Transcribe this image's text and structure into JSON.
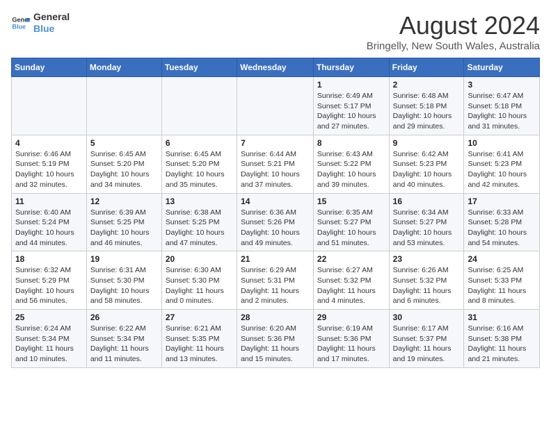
{
  "logo": {
    "line1": "General",
    "line2": "Blue"
  },
  "title": "August 2024",
  "subtitle": "Bringelly, New South Wales, Australia",
  "weekdays": [
    "Sunday",
    "Monday",
    "Tuesday",
    "Wednesday",
    "Thursday",
    "Friday",
    "Saturday"
  ],
  "weeks": [
    [
      {
        "day": "",
        "info": ""
      },
      {
        "day": "",
        "info": ""
      },
      {
        "day": "",
        "info": ""
      },
      {
        "day": "",
        "info": ""
      },
      {
        "day": "1",
        "info": "Sunrise: 6:49 AM\nSunset: 5:17 PM\nDaylight: 10 hours\nand 27 minutes."
      },
      {
        "day": "2",
        "info": "Sunrise: 6:48 AM\nSunset: 5:18 PM\nDaylight: 10 hours\nand 29 minutes."
      },
      {
        "day": "3",
        "info": "Sunrise: 6:47 AM\nSunset: 5:18 PM\nDaylight: 10 hours\nand 31 minutes."
      }
    ],
    [
      {
        "day": "4",
        "info": "Sunrise: 6:46 AM\nSunset: 5:19 PM\nDaylight: 10 hours\nand 32 minutes."
      },
      {
        "day": "5",
        "info": "Sunrise: 6:45 AM\nSunset: 5:20 PM\nDaylight: 10 hours\nand 34 minutes."
      },
      {
        "day": "6",
        "info": "Sunrise: 6:45 AM\nSunset: 5:20 PM\nDaylight: 10 hours\nand 35 minutes."
      },
      {
        "day": "7",
        "info": "Sunrise: 6:44 AM\nSunset: 5:21 PM\nDaylight: 10 hours\nand 37 minutes."
      },
      {
        "day": "8",
        "info": "Sunrise: 6:43 AM\nSunset: 5:22 PM\nDaylight: 10 hours\nand 39 minutes."
      },
      {
        "day": "9",
        "info": "Sunrise: 6:42 AM\nSunset: 5:23 PM\nDaylight: 10 hours\nand 40 minutes."
      },
      {
        "day": "10",
        "info": "Sunrise: 6:41 AM\nSunset: 5:23 PM\nDaylight: 10 hours\nand 42 minutes."
      }
    ],
    [
      {
        "day": "11",
        "info": "Sunrise: 6:40 AM\nSunset: 5:24 PM\nDaylight: 10 hours\nand 44 minutes."
      },
      {
        "day": "12",
        "info": "Sunrise: 6:39 AM\nSunset: 5:25 PM\nDaylight: 10 hours\nand 46 minutes."
      },
      {
        "day": "13",
        "info": "Sunrise: 6:38 AM\nSunset: 5:25 PM\nDaylight: 10 hours\nand 47 minutes."
      },
      {
        "day": "14",
        "info": "Sunrise: 6:36 AM\nSunset: 5:26 PM\nDaylight: 10 hours\nand 49 minutes."
      },
      {
        "day": "15",
        "info": "Sunrise: 6:35 AM\nSunset: 5:27 PM\nDaylight: 10 hours\nand 51 minutes."
      },
      {
        "day": "16",
        "info": "Sunrise: 6:34 AM\nSunset: 5:27 PM\nDaylight: 10 hours\nand 53 minutes."
      },
      {
        "day": "17",
        "info": "Sunrise: 6:33 AM\nSunset: 5:28 PM\nDaylight: 10 hours\nand 54 minutes."
      }
    ],
    [
      {
        "day": "18",
        "info": "Sunrise: 6:32 AM\nSunset: 5:29 PM\nDaylight: 10 hours\nand 56 minutes."
      },
      {
        "day": "19",
        "info": "Sunrise: 6:31 AM\nSunset: 5:30 PM\nDaylight: 10 hours\nand 58 minutes."
      },
      {
        "day": "20",
        "info": "Sunrise: 6:30 AM\nSunset: 5:30 PM\nDaylight: 11 hours\nand 0 minutes."
      },
      {
        "day": "21",
        "info": "Sunrise: 6:29 AM\nSunset: 5:31 PM\nDaylight: 11 hours\nand 2 minutes."
      },
      {
        "day": "22",
        "info": "Sunrise: 6:27 AM\nSunset: 5:32 PM\nDaylight: 11 hours\nand 4 minutes."
      },
      {
        "day": "23",
        "info": "Sunrise: 6:26 AM\nSunset: 5:32 PM\nDaylight: 11 hours\nand 6 minutes."
      },
      {
        "day": "24",
        "info": "Sunrise: 6:25 AM\nSunset: 5:33 PM\nDaylight: 11 hours\nand 8 minutes."
      }
    ],
    [
      {
        "day": "25",
        "info": "Sunrise: 6:24 AM\nSunset: 5:34 PM\nDaylight: 11 hours\nand 10 minutes."
      },
      {
        "day": "26",
        "info": "Sunrise: 6:22 AM\nSunset: 5:34 PM\nDaylight: 11 hours\nand 11 minutes."
      },
      {
        "day": "27",
        "info": "Sunrise: 6:21 AM\nSunset: 5:35 PM\nDaylight: 11 hours\nand 13 minutes."
      },
      {
        "day": "28",
        "info": "Sunrise: 6:20 AM\nSunset: 5:36 PM\nDaylight: 11 hours\nand 15 minutes."
      },
      {
        "day": "29",
        "info": "Sunrise: 6:19 AM\nSunset: 5:36 PM\nDaylight: 11 hours\nand 17 minutes."
      },
      {
        "day": "30",
        "info": "Sunrise: 6:17 AM\nSunset: 5:37 PM\nDaylight: 11 hours\nand 19 minutes."
      },
      {
        "day": "31",
        "info": "Sunrise: 6:16 AM\nSunset: 5:38 PM\nDaylight: 11 hours\nand 21 minutes."
      }
    ]
  ]
}
